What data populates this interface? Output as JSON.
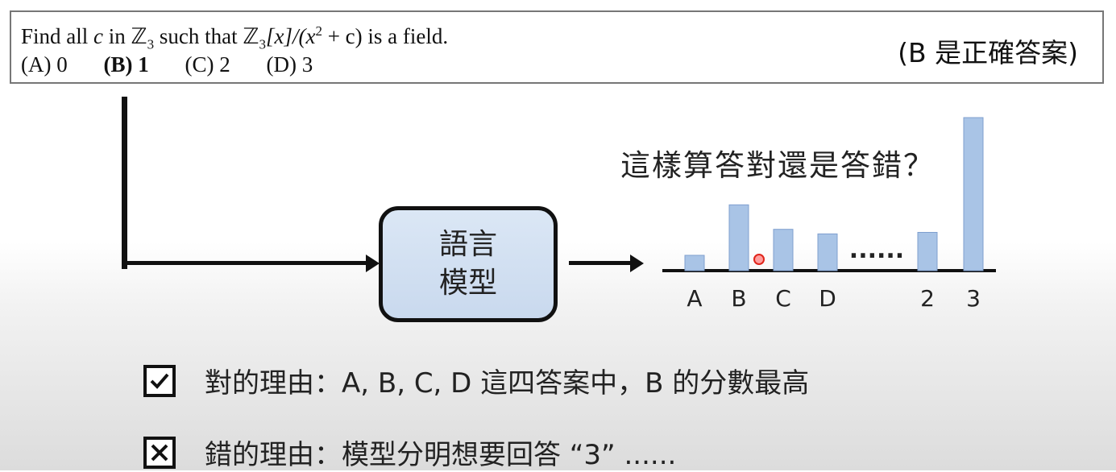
{
  "question": {
    "line_prefix": "Find all",
    "var_c": "c",
    "in_word": "in",
    "field_Z": "ℤ",
    "sub_3": "3",
    "such_that": "such that",
    "ring": "ℤ",
    "ring_sub": "3",
    "ring_rest": "[x]/(x",
    "sup_2": "2",
    "ring_tail": "+ c) is a field.",
    "options": [
      "(A) 0",
      "(B) 1",
      "(C) 2",
      "(D) 3"
    ],
    "correct_note": "(B 是正確答案)"
  },
  "model": {
    "label_line1": "語言",
    "label_line2": "模型"
  },
  "chart_question": "這樣算答對還是答錯？",
  "chart_data": {
    "type": "bar",
    "categories": [
      "A",
      "B",
      "C",
      "D",
      "",
      "2",
      "3"
    ],
    "values": [
      10,
      43,
      27,
      24,
      null,
      25,
      100
    ],
    "ellipsis_label": "......",
    "bar_color": "#a9c4e6",
    "bar_edge": "#7f9fcf"
  },
  "reasons": {
    "right": {
      "icon": "checkbox-checked-icon",
      "text": "對的理由：A, B, C, D 這四答案中，B 的分數最高"
    },
    "wrong": {
      "icon": "checkbox-crossed-icon",
      "text": "錯的理由：模型分明想要回答 “3” ......"
    }
  }
}
